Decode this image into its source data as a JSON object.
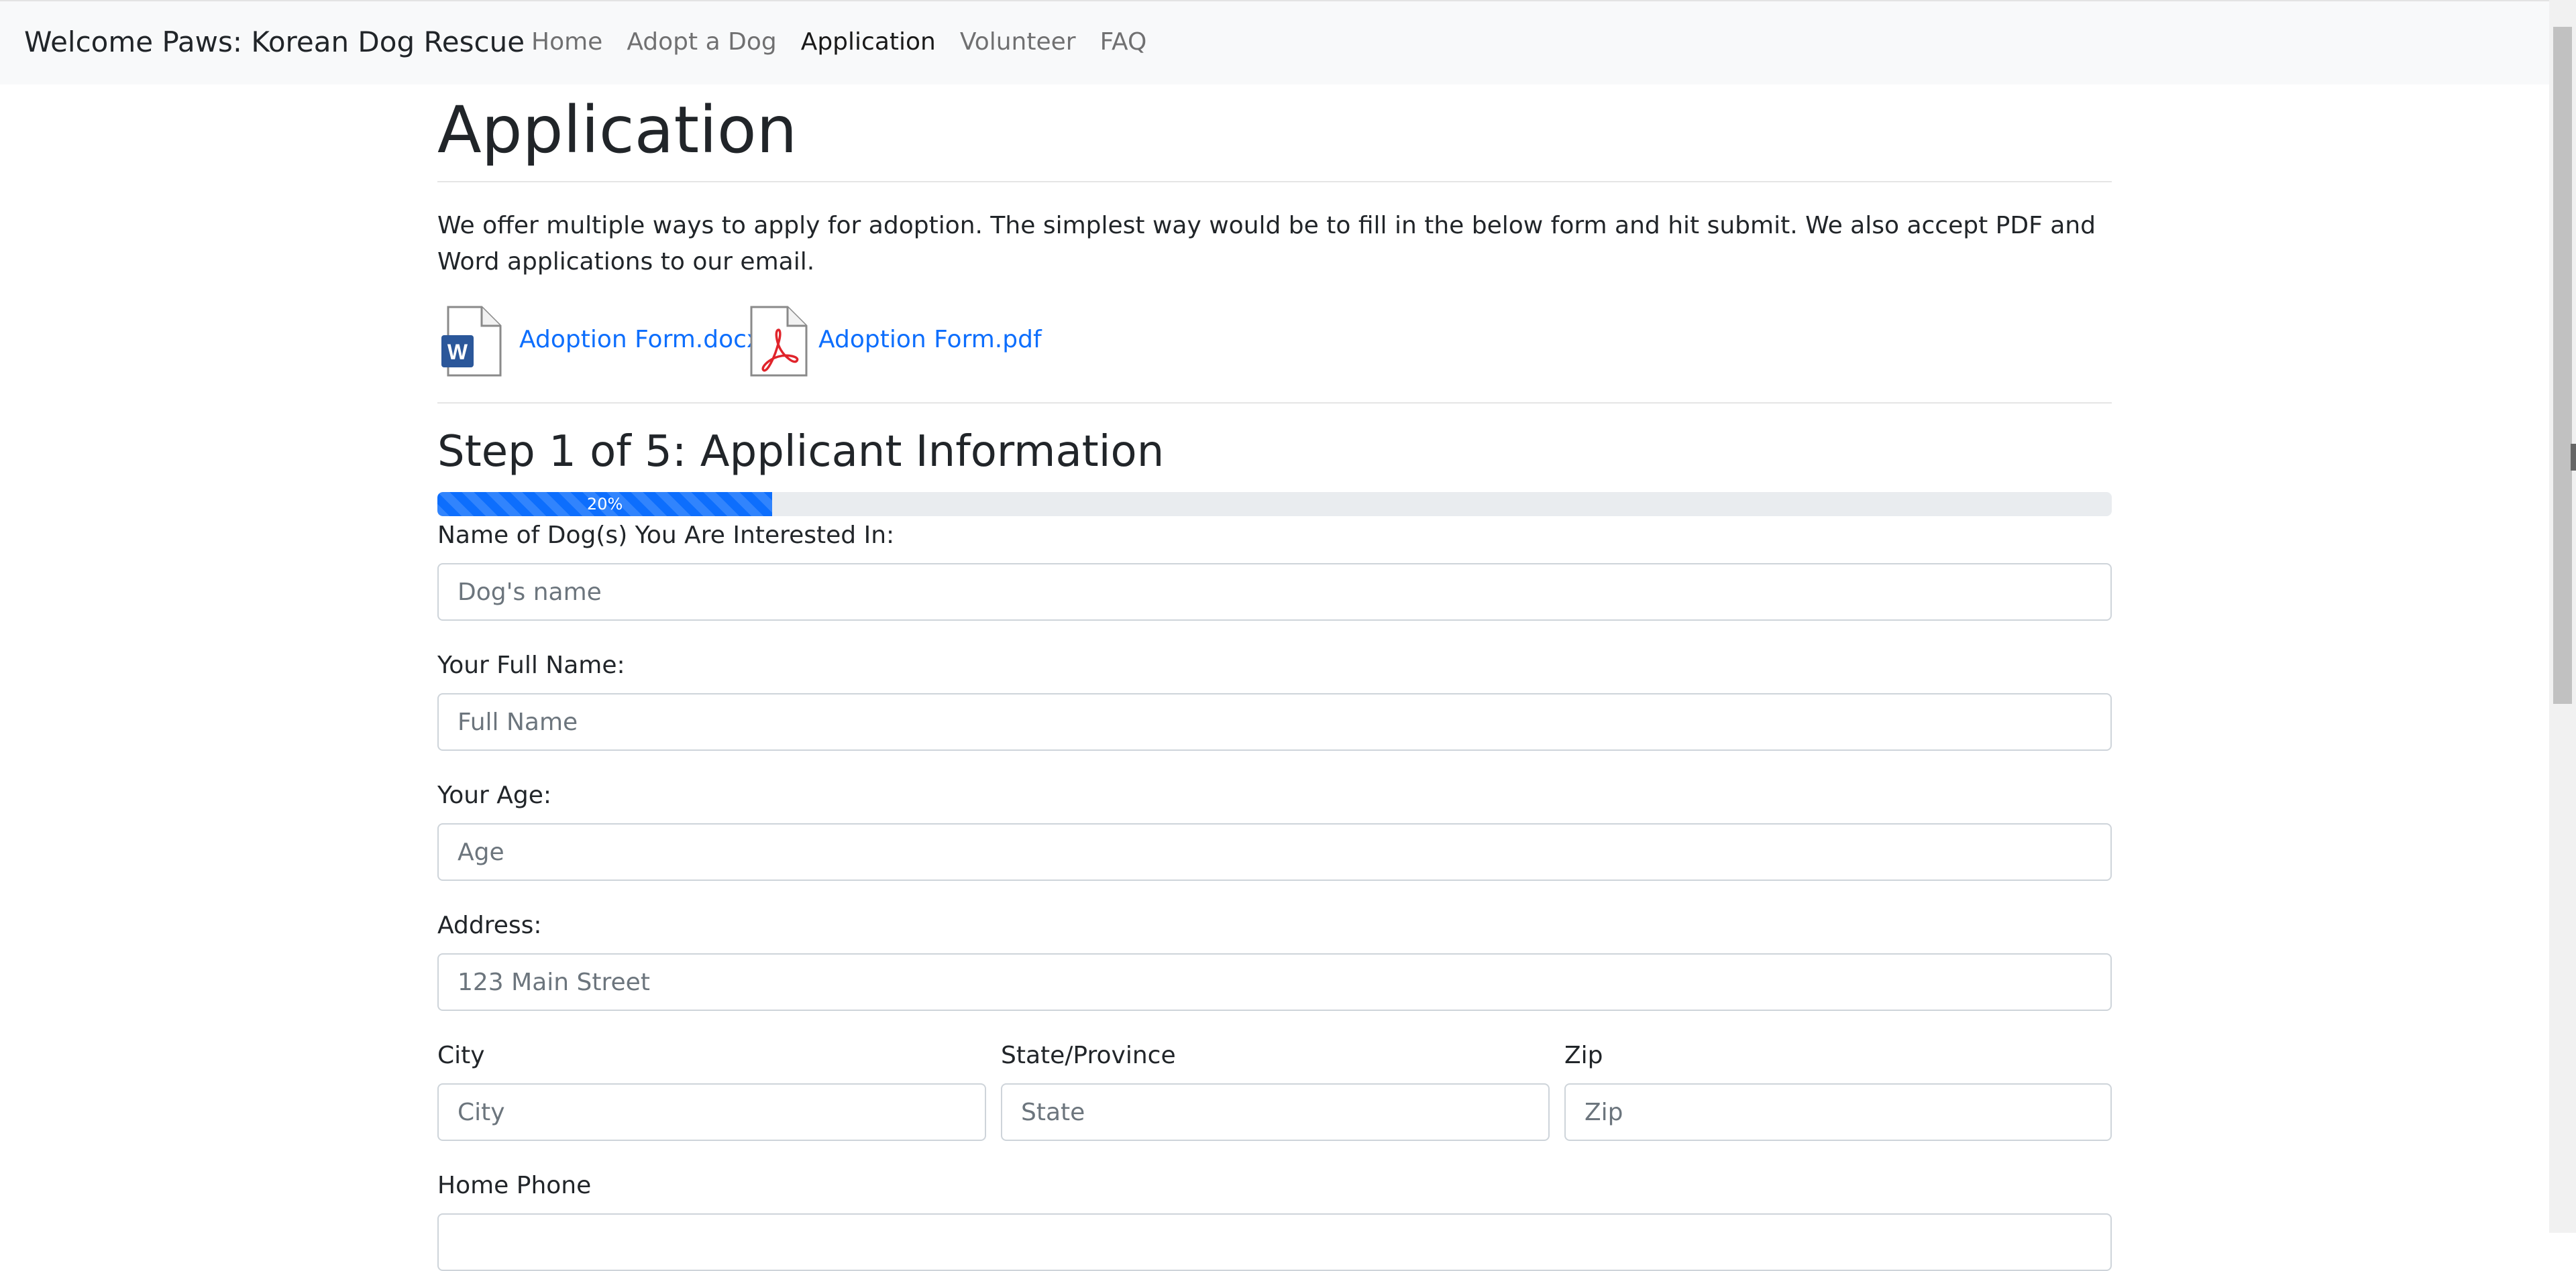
{
  "navbar": {
    "brand": "Welcome Paws: Korean Dog Rescue",
    "links": [
      "Home",
      "Adopt a Dog",
      "Application",
      "Volunteer",
      "FAQ"
    ],
    "active": "Application"
  },
  "page": {
    "title": "Application",
    "intro": "We offer multiple ways to apply for adoption. The simplest way would be to fill in the below form and hit submit. We also accept PDF and Word applications to our email.",
    "docs": [
      {
        "label": "Adoption Form.docx",
        "icon": "word-document-icon",
        "badge": "W",
        "color": "#2b579a"
      },
      {
        "label": "Adoption Form.pdf",
        "icon": "pdf-document-icon",
        "color": "#e0242b"
      }
    ]
  },
  "step": {
    "title": "Step 1 of 5: Applicant Information",
    "progress_label": "20%",
    "progress_percent": 20
  },
  "form": {
    "dog_name": {
      "label": "Name of Dog(s) You Are Interested In:",
      "placeholder": "Dog's name"
    },
    "full_name": {
      "label": "Your Full Name:",
      "placeholder": "Full Name"
    },
    "age": {
      "label": "Your Age:",
      "placeholder": "Age"
    },
    "address": {
      "label": "Address:",
      "placeholder": "123 Main Street"
    },
    "city": {
      "label": "City",
      "placeholder": "City"
    },
    "state": {
      "label": "State/Province",
      "placeholder": "State"
    },
    "zip": {
      "label": "Zip",
      "placeholder": "Zip"
    },
    "home_phone": {
      "label": "Home Phone",
      "placeholder": ""
    }
  },
  "colors": {
    "primary": "#0d6efd",
    "navbar_bg": "#f8f9fa",
    "word": "#2b579a",
    "pdf": "#e0242b"
  }
}
